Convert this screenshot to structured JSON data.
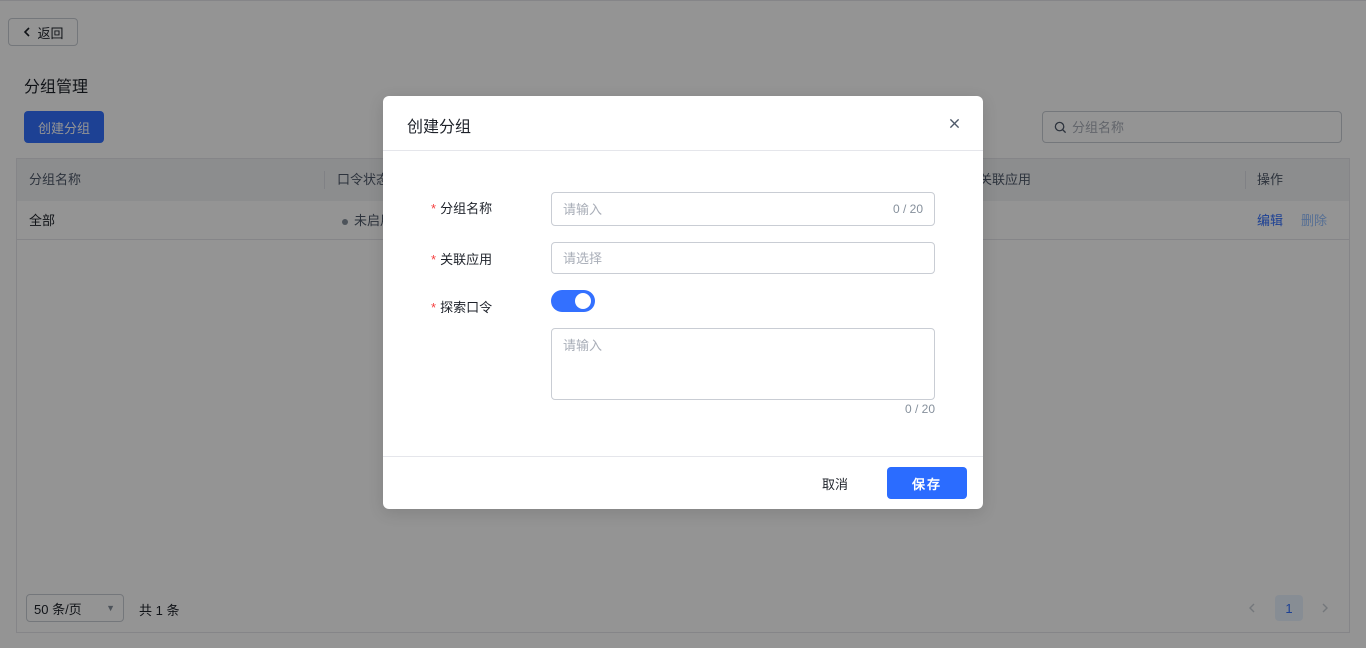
{
  "page": {
    "back_label": "返回",
    "title": "分组管理",
    "create_button_label": "创建分组",
    "search_placeholder": "分组名称"
  },
  "table": {
    "columns": [
      "分组名称",
      "口令状态",
      "关联应用",
      "操作"
    ],
    "rows": [
      {
        "name": "全部",
        "status": "未启用",
        "edit_label": "编辑",
        "delete_label": "删除"
      }
    ]
  },
  "pagination": {
    "page_size": "50 条/页",
    "total": "共 1 条",
    "current_page": "1"
  },
  "modal": {
    "title": "创建分组",
    "fields": {
      "group_name": {
        "label": "分组名称",
        "placeholder": "请输入",
        "counter": "0 / 20"
      },
      "linked_app": {
        "label": "关联应用",
        "placeholder": "请选择"
      },
      "search_code": {
        "label": "探索口令",
        "enabled": true,
        "placeholder": "请输入",
        "counter": "0 / 20"
      }
    },
    "cancel_label": "取消",
    "save_label": "保存"
  },
  "colors": {
    "primary": "#3370ff",
    "required": "#f53f3f",
    "mask": "rgba(0,0,0,0.42)"
  }
}
